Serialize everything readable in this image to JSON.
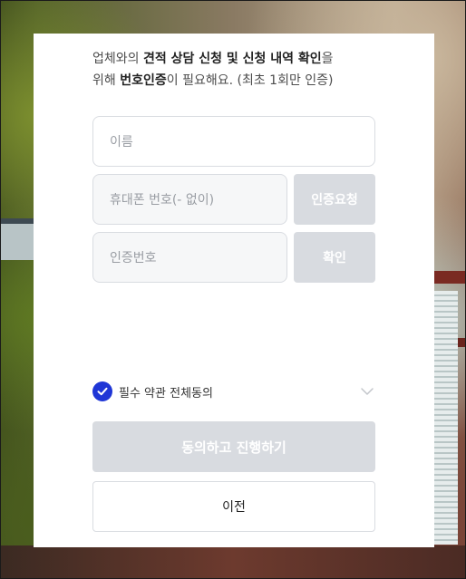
{
  "intro": {
    "part1": "업체와의 ",
    "bold1": "견적 상담 신청 및 신청 내역 확인",
    "part2": "을",
    "part3": "위해 ",
    "bold2": "번호인증",
    "part4": "이 필요해요. (최초 1회만 인증)"
  },
  "form": {
    "name_placeholder": "이름",
    "phone_placeholder": "휴대폰 번호(- 없이)",
    "request_label": "인증요청",
    "code_placeholder": "인증번호",
    "confirm_label": "확인"
  },
  "agreement": {
    "label": "필수 약관 전체동의",
    "checked": true,
    "check_icon": "check-icon",
    "expand_icon": "chevron-down-icon"
  },
  "buttons": {
    "submit_label": "동의하고 진행하기",
    "prev_label": "이전"
  },
  "colors": {
    "accent": "#1f36d6",
    "disabled_button": "#d8dbe0",
    "field_border": "#d9dce1"
  }
}
